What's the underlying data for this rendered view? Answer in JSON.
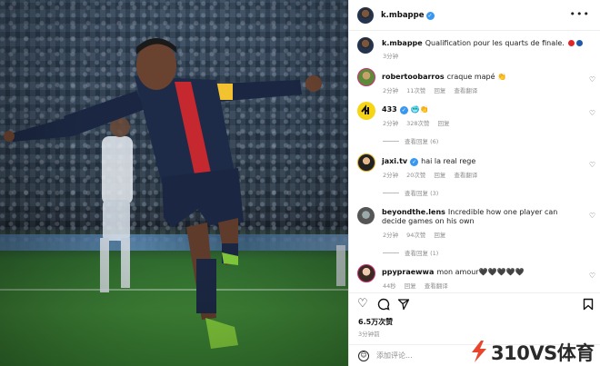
{
  "post": {
    "author": "k.mbappe",
    "caption_text": "Qualification pour les quarts de finale.",
    "caption_time": "3分钟",
    "flag_colors": [
      "#e0252b",
      "#1e5aa8"
    ]
  },
  "comments": [
    {
      "user": "robertoobarros",
      "text": "craque mapé",
      "emoji": "👏",
      "time": "2分钟",
      "likes": "11次赞",
      "reply": "回复",
      "translate": "查看翻译",
      "verified": false
    },
    {
      "user": "433",
      "text": "",
      "emoji": "🥶👏",
      "time": "2分钟",
      "likes": "328次赞",
      "reply": "回复",
      "translate": "",
      "verified": true,
      "view_replies": "查看回复 (6)"
    },
    {
      "user": "jaxi.tv",
      "text": "hai la real rege",
      "emoji": "",
      "time": "2分钟",
      "likes": "20次赞",
      "reply": "回复",
      "translate": "查看翻译",
      "verified": true,
      "view_replies": "查看回复 (3)"
    },
    {
      "user": "beyondthe.lens",
      "text": "Incredible how one player can decide games on his own",
      "emoji": "",
      "time": "2分钟",
      "likes": "94次赞",
      "reply": "回复",
      "translate": "",
      "verified": false,
      "view_replies": "查看回复 (1)"
    },
    {
      "user": "ppypraewwa",
      "text": "mon amour",
      "emoji": "🖤🖤🖤🖤🖤",
      "time": "44秒",
      "likes": "",
      "reply": "回复",
      "translate": "查看翻译",
      "verified": false
    }
  ],
  "translate_label": "查看翻译",
  "footer": {
    "likes": "6.5万次赞",
    "time_ago": "3分钟前",
    "add_comment_placeholder": "添加评论..."
  },
  "watermark": {
    "text": "310VS体育",
    "color": "#e8452c"
  },
  "icons": [
    "more-icon",
    "heart-icon",
    "comment-icon",
    "share-icon",
    "bookmark-icon",
    "emoji-icon",
    "verified-icon"
  ]
}
